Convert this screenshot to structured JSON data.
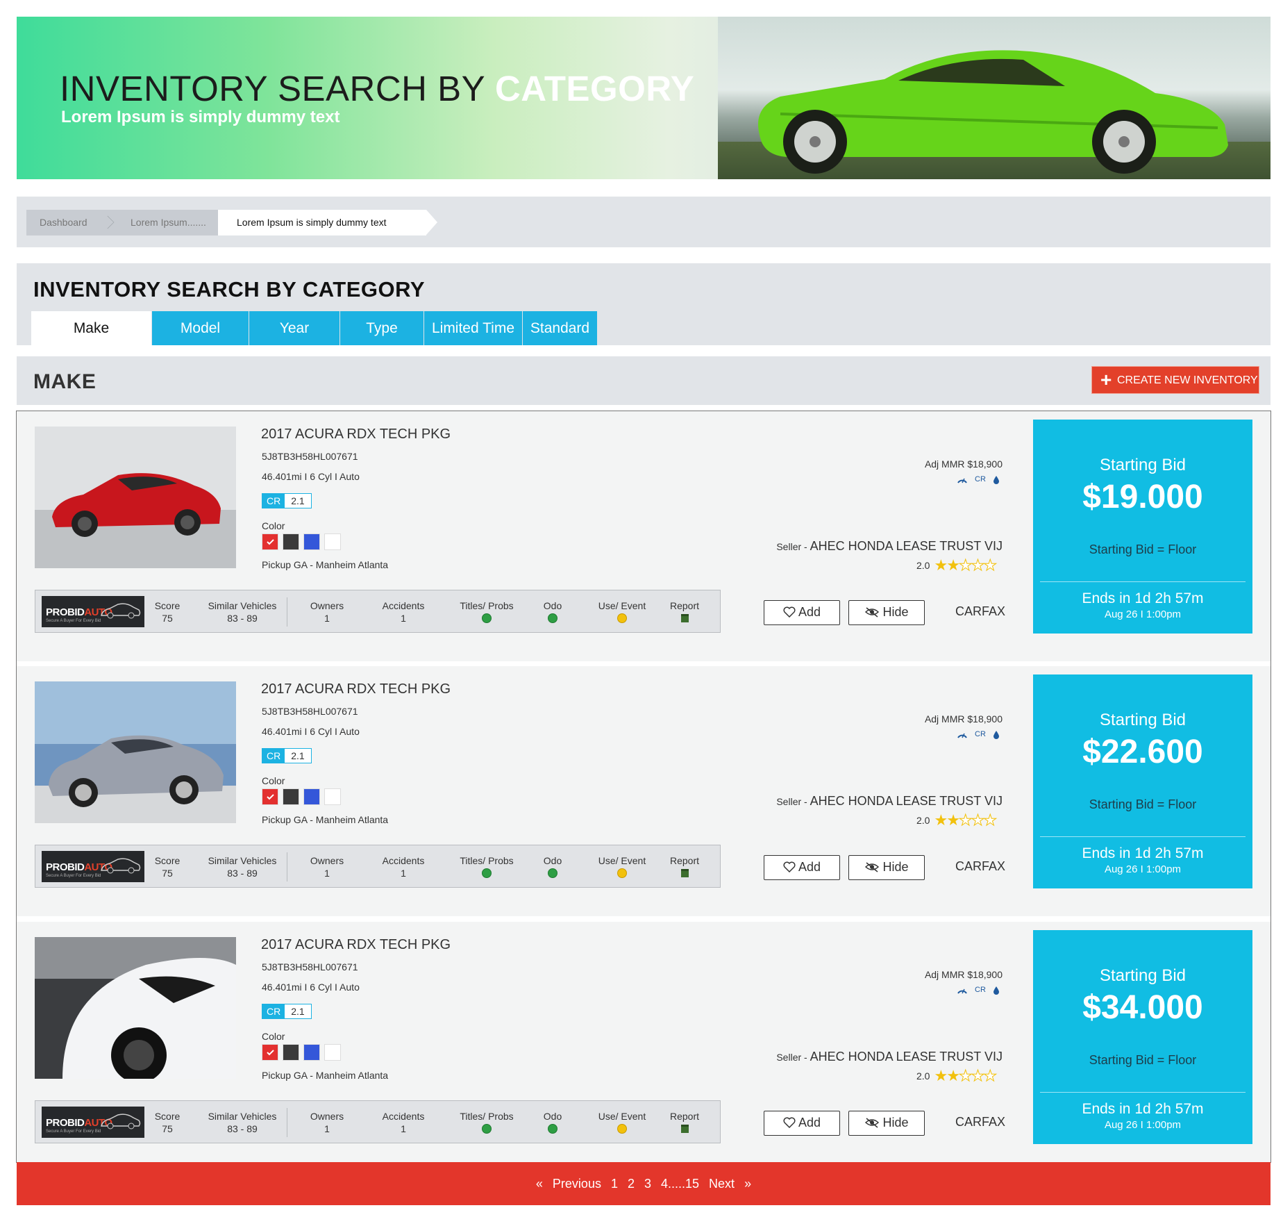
{
  "hero": {
    "title_main": "INVENTORY SEARCH BY ",
    "title_accent": "CATEGORY",
    "subtitle": "Lorem Ipsum is simply dummy text"
  },
  "breadcrumb": [
    "Dashboard",
    "Lorem Ipsum.......",
    "Lorem Ipsum is simply dummy text"
  ],
  "category": {
    "title": "INVENTORY SEARCH BY CATEGORY",
    "tabs": [
      "Make",
      "Model",
      "Year",
      "Type",
      "Limited Time",
      "Standard"
    ],
    "active_tab": "Make"
  },
  "make": {
    "title": "MAKE",
    "create_button": "CREATE NEW INVENTORY"
  },
  "listings": [
    {
      "title": "2017 ACURA RDX TECH PKG",
      "vin": "5J8TB3H58HL007671",
      "spec": "46.401mi I 6 Cyl I Auto",
      "cr_label": "CR",
      "cr_value": "2.1",
      "color_label": "Color",
      "pickup": "Pickup GA - Manheim Atlanta",
      "mmr": "Adj MMR $18,900",
      "mmr_cr": "CR",
      "seller_prefix": "Seller - ",
      "seller": "AHEC HONDA LEASE TRUST VIJ",
      "rating": "2.0",
      "stats": {
        "score_label": "Score",
        "score": "75",
        "similar_label": "Similar Vehicles",
        "similar": "83 - 89",
        "owners_label": "Owners",
        "owners": "1",
        "accidents_label": "Accidents",
        "accidents": "1",
        "titles_label": "Titles/ Probs",
        "odo_label": "Odo",
        "use_label": "Use/ Event",
        "report_label": "Report"
      },
      "add": "Add",
      "hide": "Hide",
      "carfax": "CARFAX",
      "bid_label": "Starting Bid",
      "bid": "$19.000",
      "floor": "Starting Bid = Floor",
      "ends": "Ends in 1d 2h 57m",
      "date": "Aug 26 I 1:00pm"
    },
    {
      "title": "2017 ACURA RDX TECH PKG",
      "vin": "5J8TB3H58HL007671",
      "spec": "46.401mi I 6 Cyl I Auto",
      "cr_label": "CR",
      "cr_value": "2.1",
      "color_label": "Color",
      "pickup": "Pickup GA - Manheim Atlanta",
      "mmr": "Adj MMR $18,900",
      "mmr_cr": "CR",
      "seller_prefix": "Seller - ",
      "seller": "AHEC HONDA LEASE TRUST VIJ",
      "rating": "2.0",
      "stats": {
        "score_label": "Score",
        "score": "75",
        "similar_label": "Similar Vehicles",
        "similar": "83 - 89",
        "owners_label": "Owners",
        "owners": "1",
        "accidents_label": "Accidents",
        "accidents": "1",
        "titles_label": "Titles/ Probs",
        "odo_label": "Odo",
        "use_label": "Use/ Event",
        "report_label": "Report"
      },
      "add": "Add",
      "hide": "Hide",
      "carfax": "CARFAX",
      "bid_label": "Starting Bid",
      "bid": "$22.600",
      "floor": "Starting Bid = Floor",
      "ends": "Ends in 1d 2h 57m",
      "date": "Aug 26 I 1:00pm"
    },
    {
      "title": "2017 ACURA RDX TECH PKG",
      "vin": "5J8TB3H58HL007671",
      "spec": "46.401mi I 6 Cyl I Auto",
      "cr_label": "CR",
      "cr_value": "2.1",
      "color_label": "Color",
      "pickup": "Pickup GA - Manheim Atlanta",
      "mmr": "Adj MMR $18,900",
      "mmr_cr": "CR",
      "seller_prefix": "Seller - ",
      "seller": "AHEC HONDA LEASE TRUST VIJ",
      "rating": "2.0",
      "stats": {
        "score_label": "Score",
        "score": "75",
        "similar_label": "Similar Vehicles",
        "similar": "83 - 89",
        "owners_label": "Owners",
        "owners": "1",
        "accidents_label": "Accidents",
        "accidents": "1",
        "titles_label": "Titles/ Probs",
        "odo_label": "Odo",
        "use_label": "Use/ Event",
        "report_label": "Report"
      },
      "add": "Add",
      "hide": "Hide",
      "carfax": "CARFAX",
      "bid_label": "Starting Bid",
      "bid": "$34.000",
      "floor": "Starting Bid = Floor",
      "ends": "Ends in 1d 2h 57m",
      "date": "Aug 26 I 1:00pm"
    }
  ],
  "logo": {
    "brand_a": "PROBID",
    "brand_b": "AUTO",
    "tagline": "Secure A Buyer For Every Bid"
  },
  "swatch_colors": [
    "#e3302f",
    "#3a3a3a",
    "#3457d9",
    "#ffffff"
  ],
  "pager": {
    "prev": "Previous",
    "pages": [
      "1",
      "2",
      "3",
      "4.....15"
    ],
    "next": "Next",
    "prev_icon": "«",
    "next_icon": "»"
  },
  "colors": {
    "accent": "#1cb2e2",
    "bid_bg": "#11bde3",
    "danger": "#e3402a"
  }
}
